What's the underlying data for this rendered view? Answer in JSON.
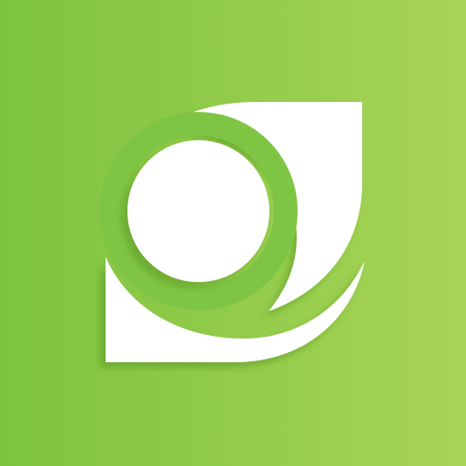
{
  "icon": {
    "semantic_name": "leaf-ring-logo-icon",
    "background_gradient": [
      "#7dc33f",
      "#a8d457"
    ],
    "mark_color": "#ffffff",
    "shadow_color": "#5f9f2a"
  }
}
